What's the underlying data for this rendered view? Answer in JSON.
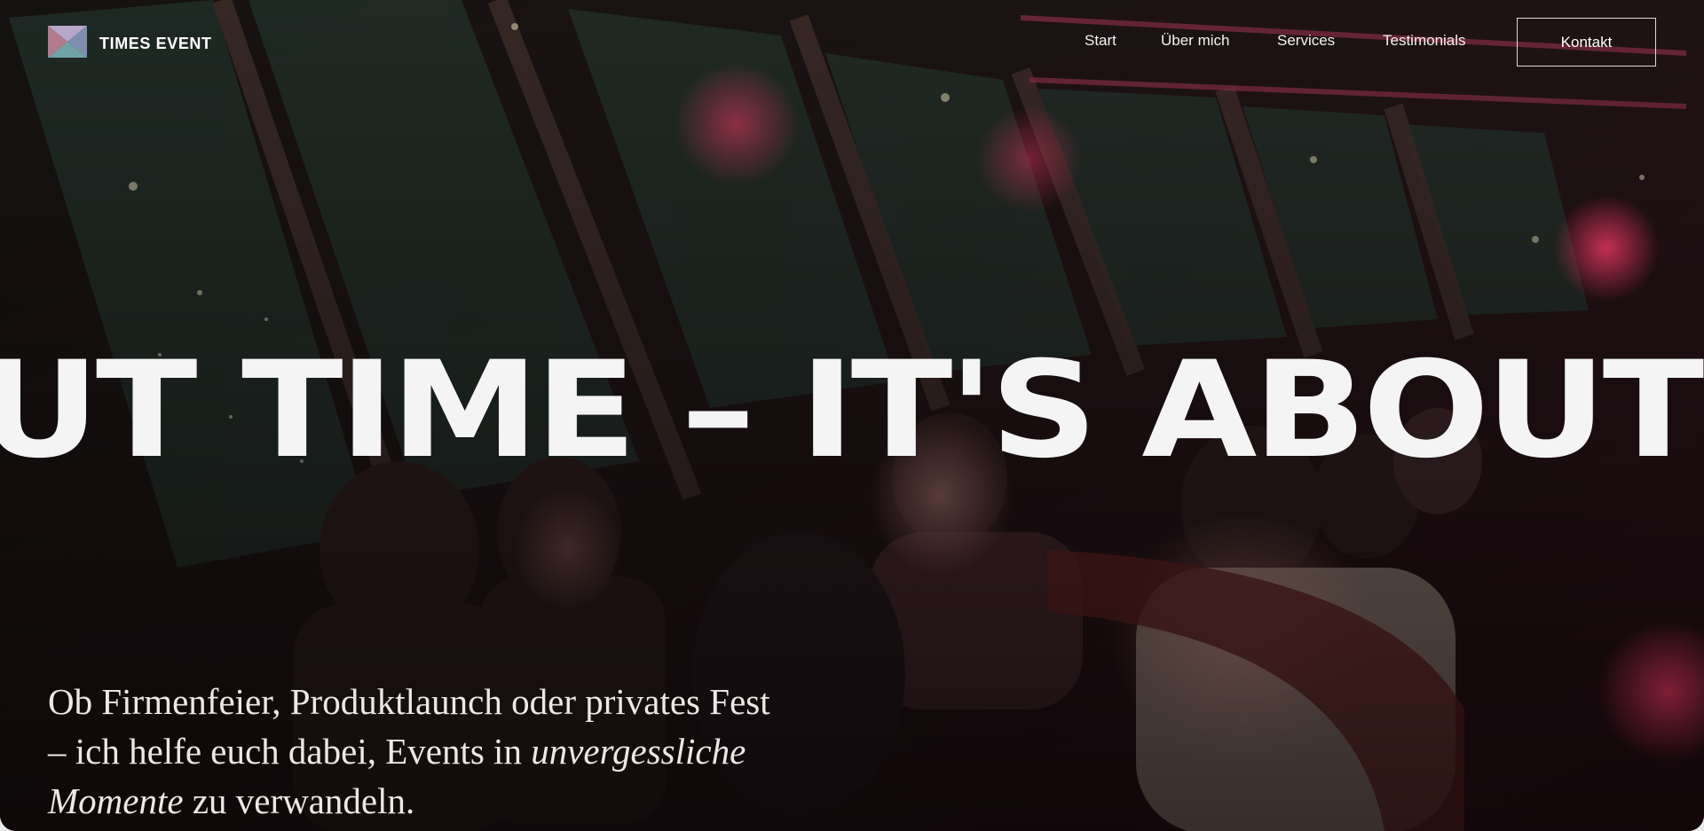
{
  "brand": {
    "name": "TIMES EVENT",
    "logo_icon": "hourglass-logo-icon"
  },
  "nav": {
    "items": [
      "Start",
      "Über mich",
      "Services",
      "Testimonials"
    ],
    "contact_label": "Kontakt"
  },
  "hero": {
    "marquee_text": "UT TIME – IT'S ABOUT",
    "tagline_part1": "Ob Firmenfeier, Produktlaunch oder privates Fest – ich helfe euch dabei, Events in ",
    "tagline_emphasis": "unvergessliche Momente",
    "tagline_part2": " zu verwandeln."
  },
  "colors": {
    "background": "#140a0c",
    "accent_pink": "#d9305a",
    "text_light": "#f4f4f4"
  }
}
